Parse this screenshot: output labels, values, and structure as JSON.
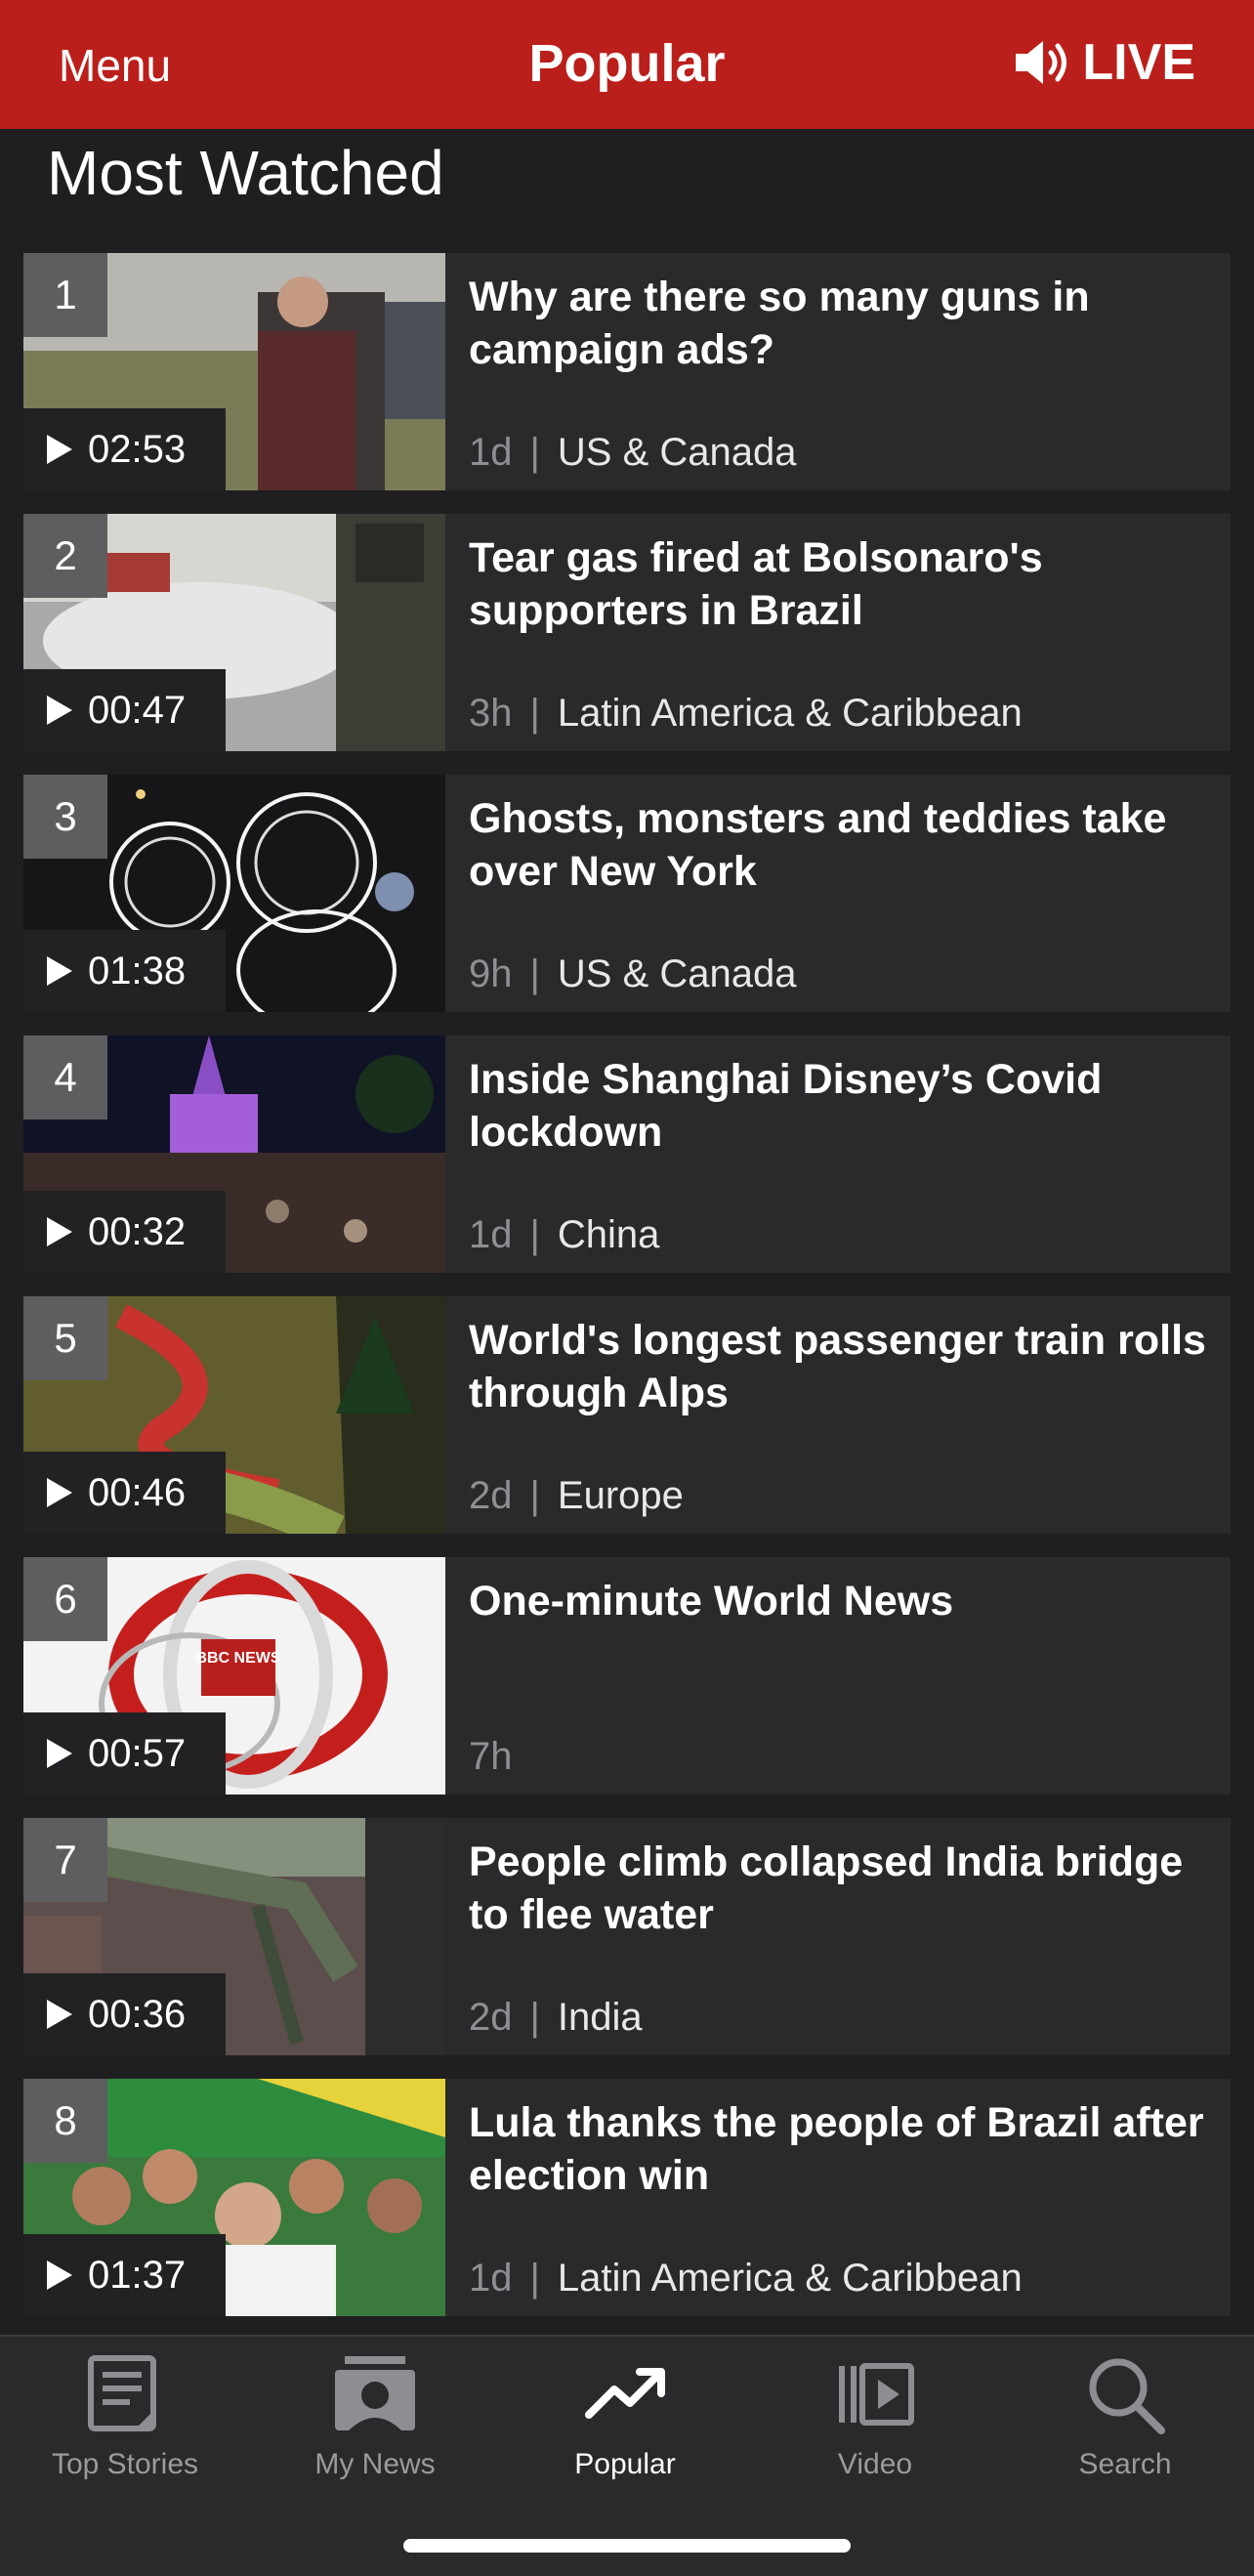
{
  "header": {
    "menu_label": "Menu",
    "title": "Popular",
    "live_label": "LIVE",
    "live_icon": "speaker-icon",
    "bar_color": "#bb1f1b"
  },
  "section": {
    "title": "Most Watched"
  },
  "items": [
    {
      "rank": "1",
      "duration": "02:53",
      "headline": "Why are there so many guns in campaign ads?",
      "time": "1d",
      "category": "US & Canada"
    },
    {
      "rank": "2",
      "duration": "00:47",
      "headline": "Tear gas fired at Bolsonaro's supporters in Brazil",
      "time": "3h",
      "category": "Latin America & Caribbean"
    },
    {
      "rank": "3",
      "duration": "01:38",
      "headline": "Ghosts, monsters and teddies take over New York",
      "time": "9h",
      "category": "US & Canada"
    },
    {
      "rank": "4",
      "duration": "00:32",
      "headline": "Inside Shanghai Disney’s Covid lockdown",
      "time": "1d",
      "category": "China"
    },
    {
      "rank": "5",
      "duration": "00:46",
      "headline": "World's longest passenger train rolls through Alps",
      "time": "2d",
      "category": "Europe"
    },
    {
      "rank": "6",
      "duration": "00:57",
      "headline": "One-minute World News",
      "time": "7h",
      "category": "",
      "thumb_text": "BBC NEWS"
    },
    {
      "rank": "7",
      "duration": "00:36",
      "headline": "People climb collapsed India bridge to flee water",
      "time": "2d",
      "category": "India"
    },
    {
      "rank": "8",
      "duration": "01:37",
      "headline": "Lula thanks the people of Brazil after election win",
      "time": "1d",
      "category": "Latin America & Caribbean"
    }
  ],
  "separator": "|",
  "tabs": [
    {
      "label": "Top Stories",
      "icon": "newspaper-icon",
      "active": false
    },
    {
      "label": "My News",
      "icon": "person-news-icon",
      "active": false
    },
    {
      "label": "Popular",
      "icon": "trending-icon",
      "active": true
    },
    {
      "label": "Video",
      "icon": "video-icon",
      "active": false
    },
    {
      "label": "Search",
      "icon": "search-icon",
      "active": false
    }
  ]
}
